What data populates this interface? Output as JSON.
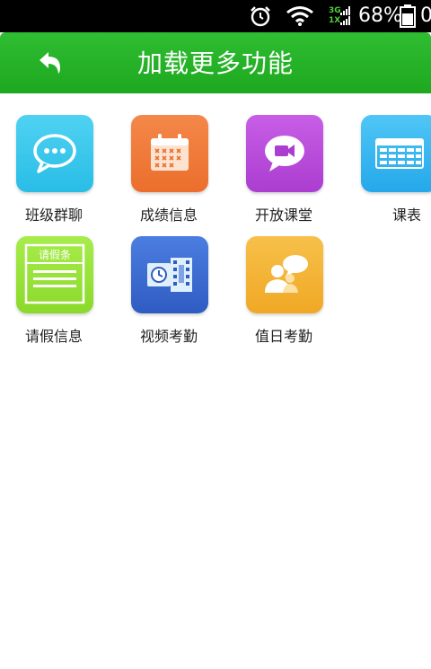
{
  "status_bar": {
    "network_top": "3G",
    "network_bottom": "1X",
    "battery_percent": "68%",
    "clock_partial": "0"
  },
  "header": {
    "title": "加载更多功能"
  },
  "features": [
    {
      "label": "班级群聊",
      "icon": "chat-bubble-icon",
      "color": "#36c8ee"
    },
    {
      "label": "成绩信息",
      "icon": "calendar-grades-icon",
      "color": "#f07a37"
    },
    {
      "label": "开放课堂",
      "icon": "video-chat-icon",
      "color": "#b94bdb"
    },
    {
      "label": "课表",
      "icon": "timetable-icon",
      "color": "#35b5f0"
    },
    {
      "label": "请假信息",
      "icon": "leave-slip-icon",
      "color": "#9ae23c",
      "icon_text": "请假条"
    },
    {
      "label": "视频考勤",
      "icon": "film-clock-icon",
      "color": "#3b6cd2"
    },
    {
      "label": "值日考勤",
      "icon": "people-speech-icon",
      "color": "#f4b432"
    }
  ]
}
